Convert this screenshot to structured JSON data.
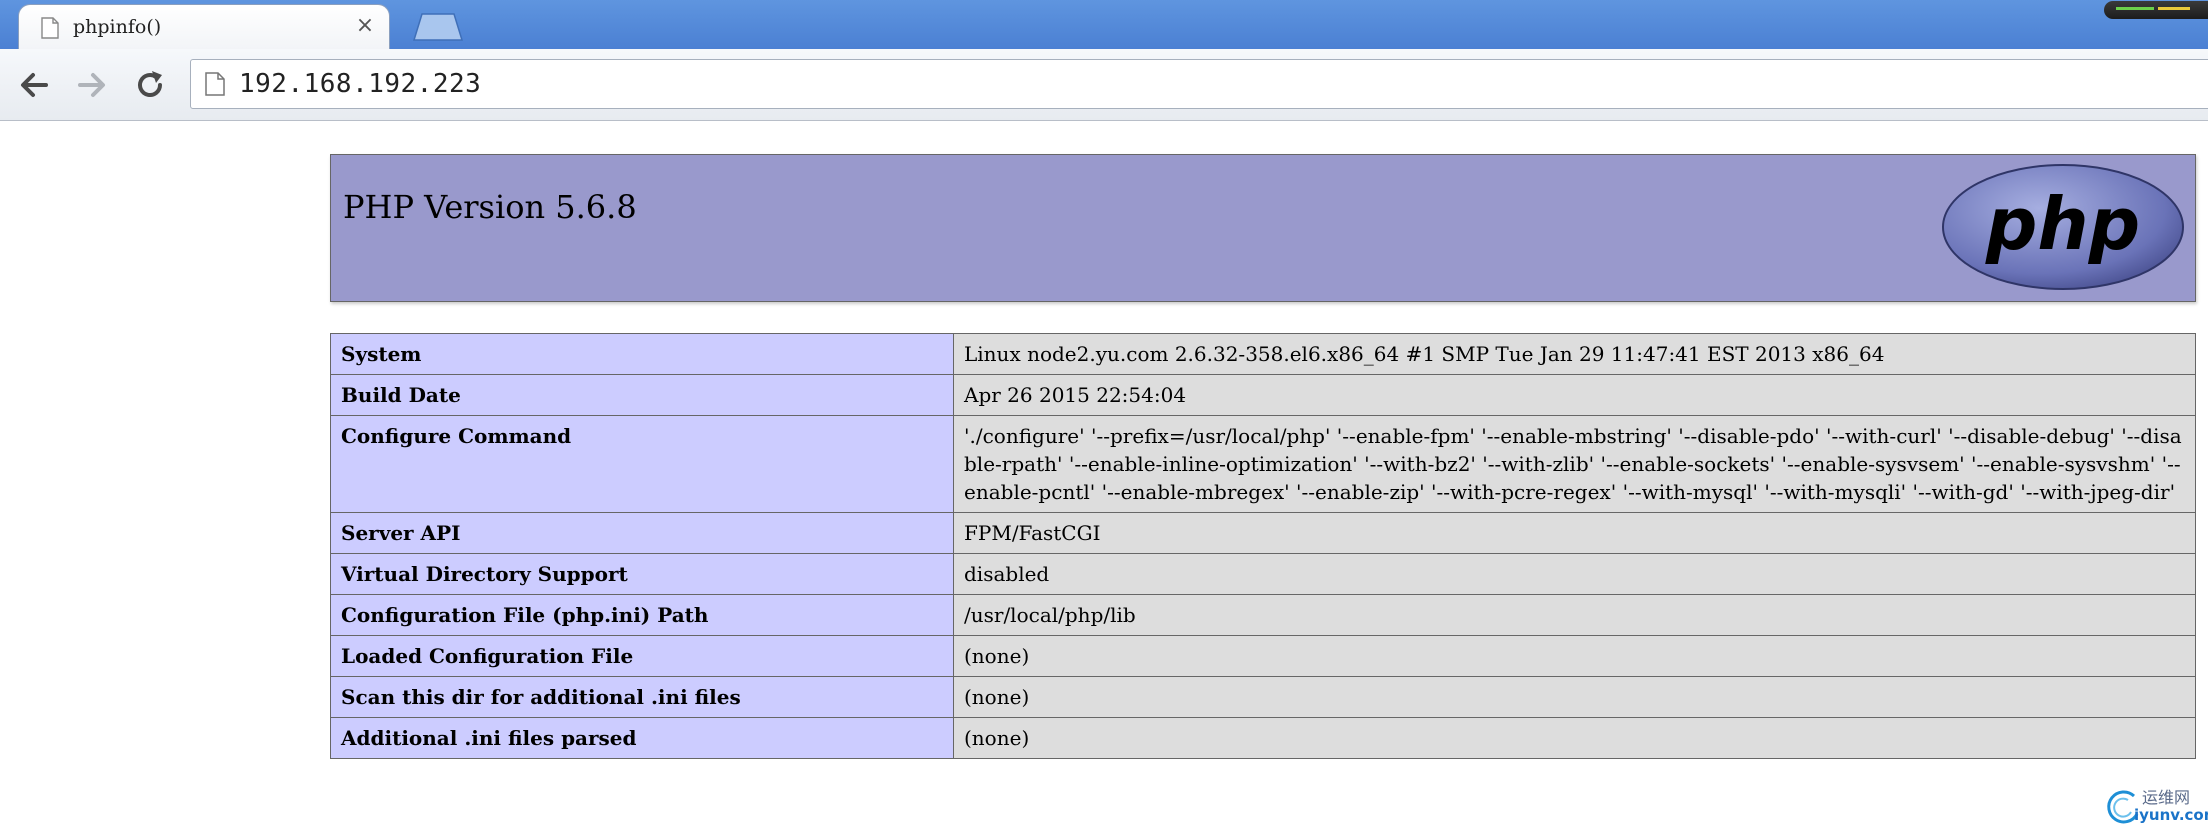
{
  "browser": {
    "tab": {
      "title": "phpinfo()",
      "close_glyph": "×",
      "favicon": "page-icon"
    },
    "new_tab": "new-tab-icon",
    "nav": {
      "back": "back-arrow-icon",
      "forward": "forward-arrow-icon",
      "reload": "reload-icon"
    },
    "address_bar": {
      "url": "192.168.192.223",
      "page_icon": "page-icon"
    }
  },
  "phpinfo": {
    "header": {
      "title": "PHP Version 5.6.8",
      "logo": "php-logo"
    },
    "rows": [
      {
        "key": "System",
        "value": "Linux node2.yu.com 2.6.32-358.el6.x86_64 #1 SMP Tue Jan 29 11:47:41 EST 2013 x86_64"
      },
      {
        "key": "Build Date",
        "value": "Apr 26 2015 22:54:04"
      },
      {
        "key": "Configure Command",
        "value": "'./configure' '--prefix=/usr/local/php' '--enable-fpm' '--enable-mbstring' '--disable-pdo' '--with-curl' '--disable-debug' '--disable-rpath' '--enable-inline-optimization' '--with-bz2' '--with-zlib' '--enable-sockets' '--enable-sysvsem' '--enable-sysvshm' '--enable-pcntl' '--enable-mbregex' '--enable-zip' '--with-pcre-regex' '--with-mysql' '--with-mysqli' '--with-gd' '--with-jpeg-dir'"
      },
      {
        "key": "Server API",
        "value": "FPM/FastCGI"
      },
      {
        "key": "Virtual Directory Support",
        "value": "disabled"
      },
      {
        "key": "Configuration File (php.ini) Path",
        "value": "/usr/local/php/lib"
      },
      {
        "key": "Loaded Configuration File",
        "value": "(none)"
      },
      {
        "key": "Scan this dir for additional .ini files",
        "value": "(none)"
      },
      {
        "key": "Additional .ini files parsed",
        "value": "(none)"
      }
    ]
  },
  "watermark": {
    "cn": "运维网",
    "en": "iyunv.com"
  },
  "colors": {
    "header_bg": "#9999cc",
    "key_bg": "#ccccff",
    "value_bg": "#dddddd",
    "chrome_blue": "#5f95df"
  }
}
